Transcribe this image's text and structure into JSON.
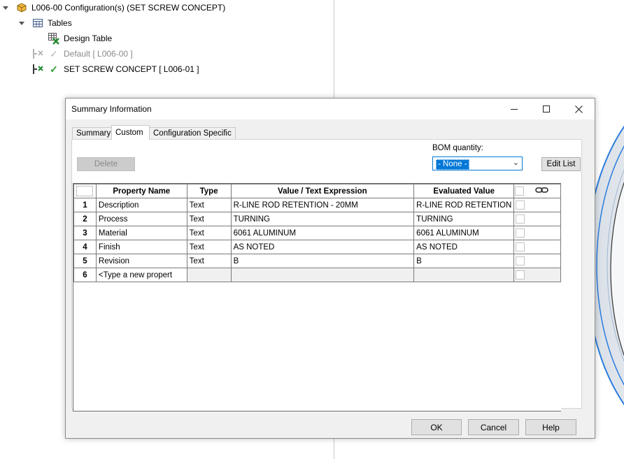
{
  "tree": {
    "root": "L006-00 Configuration(s)  (SET SCREW CONCEPT)",
    "tables": "Tables",
    "design_table": "Design Table",
    "config_default": "Default [ L006-00 ]",
    "config_active": "SET SCREW CONCEPT [ L006-01 ]"
  },
  "dialog": {
    "title": "Summary Information",
    "tabs": [
      "Summary",
      "Custom",
      "Configuration Specific"
    ],
    "active_tab": "Custom",
    "delete_label": "Delete",
    "bom_label": "BOM quantity:",
    "bom_value": "- None -",
    "edit_list_label": "Edit List",
    "ok_label": "OK",
    "cancel_label": "Cancel",
    "help_label": "Help"
  },
  "grid": {
    "headers": [
      "Property Name",
      "Type",
      "Value / Text Expression",
      "Evaluated Value"
    ],
    "rows": [
      {
        "num": "1",
        "name": "Description",
        "type": "Text",
        "value": "R-LINE ROD RETENTION - 20MM",
        "evaluated": "R-LINE ROD RETENTION"
      },
      {
        "num": "2",
        "name": "Process",
        "type": "Text",
        "value": "TURNING",
        "evaluated": "TURNING"
      },
      {
        "num": "3",
        "name": "Material",
        "type": "Text",
        "value": "6061 ALUMINUM",
        "evaluated": "6061 ALUMINUM"
      },
      {
        "num": "4",
        "name": "Finish",
        "type": "Text",
        "value": "AS NOTED",
        "evaluated": "AS NOTED"
      },
      {
        "num": "5",
        "name": "Revision",
        "type": "Text",
        "value": "B",
        "evaluated": "B"
      },
      {
        "num": "6",
        "name": "<Type a new propert",
        "type": "",
        "value": "",
        "evaluated": ""
      }
    ]
  },
  "icons": {
    "assembly": "part-config-icon",
    "tables": "table-icon",
    "design_table": "design-table-icon",
    "config_inactive": "config-inactive-icon",
    "config_active": "config-active-icon",
    "link": "link-icon"
  },
  "colors": {
    "accent": "#0078d7",
    "check_active": "#2a9d2a",
    "model_edge": "#2a7ddf"
  }
}
